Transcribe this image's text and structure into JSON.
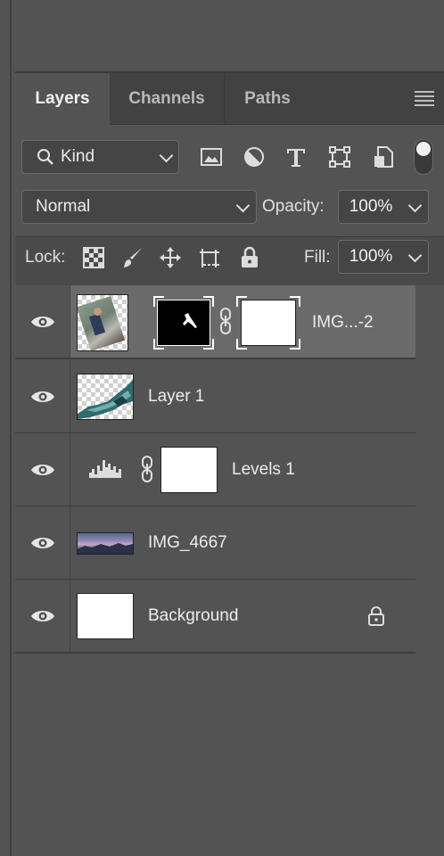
{
  "tabs": [
    {
      "label": "Layers",
      "active": true
    },
    {
      "label": "Channels",
      "active": false
    },
    {
      "label": "Paths",
      "active": false
    }
  ],
  "filter": {
    "kind_label": "Kind",
    "icons": [
      "image-filter-icon",
      "adjustment-filter-icon",
      "type-filter-icon",
      "shape-filter-icon",
      "smart-object-filter-icon"
    ],
    "filter_toggle_on": true
  },
  "blend": {
    "mode": "Normal",
    "opacity_label": "Opacity:",
    "opacity_value": "100%"
  },
  "lock": {
    "label": "Lock:",
    "icons": [
      "lock-transparent-pixels-icon",
      "lock-image-pixels-icon",
      "lock-position-icon",
      "lock-artboard-icon",
      "lock-all-icon"
    ],
    "fill_label": "Fill:",
    "fill_value": "100%"
  },
  "layers": [
    {
      "name": "IMG...-2",
      "selected": true,
      "visible": true,
      "has_mask": true,
      "has_vector_mask": true
    },
    {
      "name": "Layer 1",
      "selected": false,
      "visible": true
    },
    {
      "name": "Levels 1",
      "selected": false,
      "visible": true,
      "adjustment": "levels"
    },
    {
      "name": "IMG_4667",
      "selected": false,
      "visible": true
    },
    {
      "name": "Background",
      "selected": false,
      "visible": true,
      "locked": true
    }
  ],
  "colors": {
    "panel_bg": "#535353",
    "tabbar_bg": "#424242",
    "selected_row": "#6a6a6a"
  }
}
